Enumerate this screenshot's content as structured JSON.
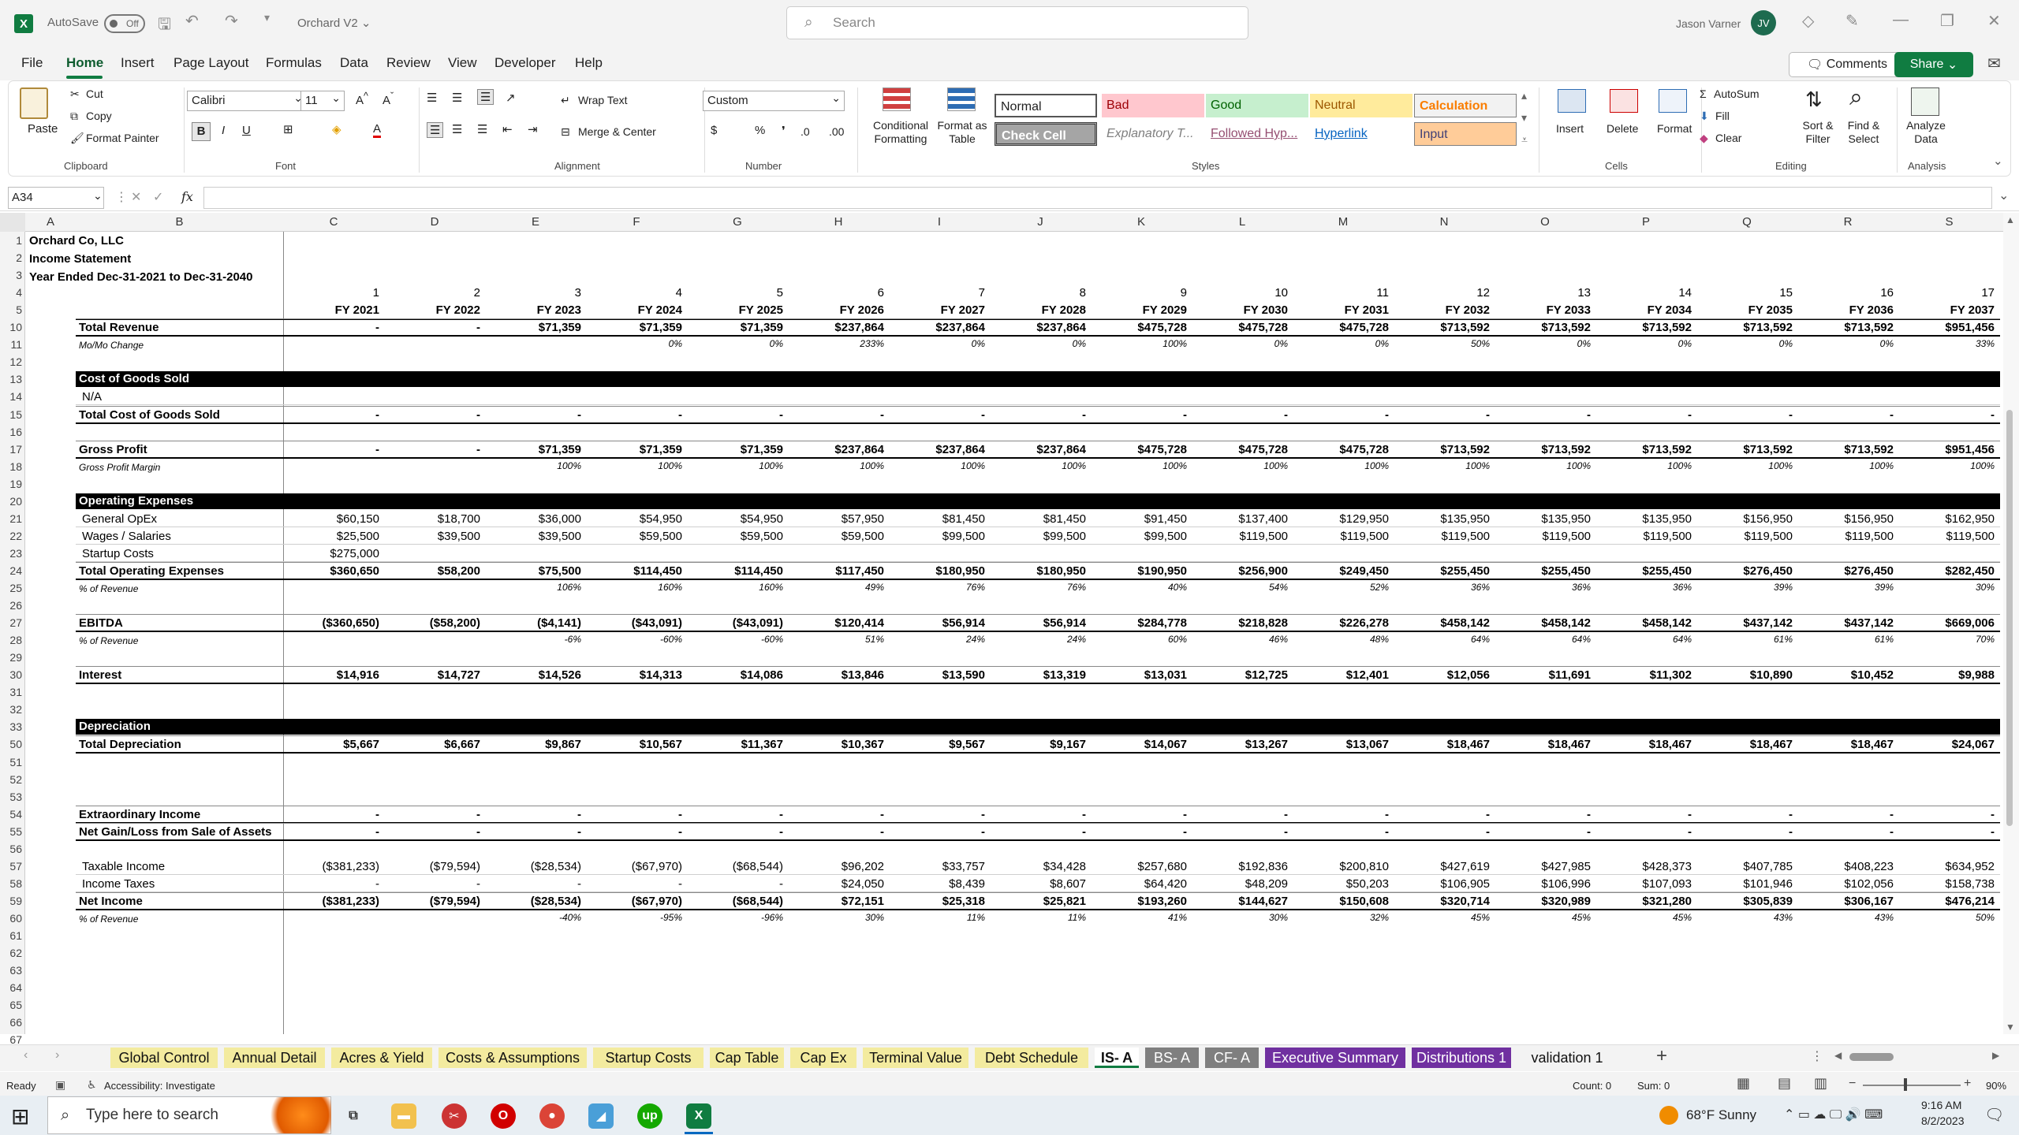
{
  "titlebar": {
    "autosave": "AutoSave",
    "toggle": "Off",
    "doc_title": "Orchard V2 ⌄",
    "search_placeholder": "Search",
    "user": "Jason Varner",
    "initials": "JV"
  },
  "menu": {
    "items": [
      "File",
      "Home",
      "Insert",
      "Page Layout",
      "Formulas",
      "Data",
      "Review",
      "View",
      "Developer",
      "Help"
    ],
    "active": "Home",
    "comments": "Comments",
    "share": "Share"
  },
  "ribbon": {
    "clipboard": {
      "paste": "Paste",
      "cut": "Cut",
      "copy": "Copy",
      "format_painter": "Format Painter",
      "label": "Clipboard"
    },
    "font": {
      "name": "Calibri",
      "size": "11",
      "bold": "B",
      "italic": "I",
      "underline": "U",
      "label": "Font"
    },
    "alignment": {
      "wrap": "Wrap Text",
      "merge": "Merge & Center",
      "label": "Alignment"
    },
    "number": {
      "format": "Custom",
      "label": "Number"
    },
    "styles": {
      "conditional": "Conditional Formatting",
      "format_table": "Format as Table",
      "cells": [
        "Normal",
        "Bad",
        "Good",
        "Neutral",
        "Calculation",
        "Check Cell",
        "Explanatory T...",
        "Followed Hyp...",
        "Hyperlink",
        "Input"
      ],
      "label": "Styles"
    },
    "cells": {
      "insert": "Insert",
      "delete": "Delete",
      "format": "Format",
      "label": "Cells"
    },
    "editing": {
      "autosum": "AutoSum",
      "fill": "Fill",
      "clear": "Clear",
      "sort": "Sort & Filter",
      "find": "Find & Select",
      "label": "Editing"
    },
    "analysis": {
      "analyze": "Analyze Data",
      "label": "Analysis"
    }
  },
  "formula": {
    "namebox": "A34",
    "fx": "fx",
    "content": ""
  },
  "columns": [
    "A",
    "B",
    "C",
    "D",
    "E",
    "F",
    "G",
    "H",
    "I",
    "J",
    "K",
    "L",
    "M",
    "N",
    "O",
    "P",
    "Q",
    "R",
    "S"
  ],
  "rows": [
    "1",
    "2",
    "3",
    "4",
    "5",
    "10",
    "11",
    "12",
    "13",
    "14",
    "15",
    "16",
    "17",
    "18",
    "19",
    "20",
    "21",
    "22",
    "23",
    "24",
    "25",
    "26",
    "27",
    "28",
    "29",
    "30",
    "31",
    "32",
    "33",
    "50",
    "51",
    "52",
    "53",
    "54",
    "55",
    "56",
    "57",
    "58",
    "59",
    "60",
    "61",
    "62",
    "63",
    "64",
    "65",
    "66",
    "67"
  ],
  "sheet": {
    "company": "Orchard Co, LLC",
    "statement": "Income Statement",
    "period": "Year Ended Dec-31-2021 to Dec-31-2040",
    "index": [
      "1",
      "2",
      "3",
      "4",
      "5",
      "6",
      "7",
      "8",
      "9",
      "10",
      "11",
      "12",
      "13",
      "14",
      "15",
      "16",
      "17"
    ],
    "years": [
      "FY 2021",
      "FY 2022",
      "FY 2023",
      "FY 2024",
      "FY 2025",
      "FY 2026",
      "FY 2027",
      "FY 2028",
      "FY 2029",
      "FY 2030",
      "FY 2031",
      "FY 2032",
      "FY 2033",
      "FY 2034",
      "FY 2035",
      "FY 2036",
      "FY 2037"
    ],
    "lines": [
      {
        "label": "Total Revenue",
        "style": "b",
        "values": [
          "-",
          "-",
          "$71,359",
          "$71,359",
          "$71,359",
          "$237,864",
          "$237,864",
          "$237,864",
          "$475,728",
          "$475,728",
          "$475,728",
          "$713,592",
          "$713,592",
          "$713,592",
          "$713,592",
          "$713,592",
          "$951,456"
        ]
      },
      {
        "label": "Mo/Mo Change",
        "style": "it",
        "values": [
          "",
          "",
          "",
          "0%",
          "0%",
          "233%",
          "0%",
          "0%",
          "100%",
          "0%",
          "0%",
          "50%",
          "0%",
          "0%",
          "0%",
          "0%",
          "33%"
        ]
      },
      {
        "label": "Cost of Goods Sold",
        "style": "bar",
        "values": []
      },
      {
        "label": "N/A",
        "style": "n",
        "values": []
      },
      {
        "label": "Total Cost of Goods Sold",
        "style": "b",
        "values": [
          "-",
          "-",
          "-",
          "-",
          "-",
          "-",
          "-",
          "-",
          "-",
          "-",
          "-",
          "-",
          "-",
          "-",
          "-",
          "-",
          "-"
        ]
      },
      {
        "label": "Gross Profit",
        "style": "b",
        "values": [
          "-",
          "-",
          "$71,359",
          "$71,359",
          "$71,359",
          "$237,864",
          "$237,864",
          "$237,864",
          "$475,728",
          "$475,728",
          "$475,728",
          "$713,592",
          "$713,592",
          "$713,592",
          "$713,592",
          "$713,592",
          "$951,456"
        ]
      },
      {
        "label": "Gross Profit Margin",
        "style": "it",
        "values": [
          "",
          "",
          "100%",
          "100%",
          "100%",
          "100%",
          "100%",
          "100%",
          "100%",
          "100%",
          "100%",
          "100%",
          "100%",
          "100%",
          "100%",
          "100%",
          "100%"
        ]
      },
      {
        "label": "Operating Expenses",
        "style": "bar",
        "values": []
      },
      {
        "label": "General OpEx",
        "style": "n",
        "values": [
          "$60,150",
          "$18,700",
          "$36,000",
          "$54,950",
          "$54,950",
          "$57,950",
          "$81,450",
          "$81,450",
          "$91,450",
          "$137,400",
          "$129,950",
          "$135,950",
          "$135,950",
          "$135,950",
          "$156,950",
          "$156,950",
          "$162,950"
        ]
      },
      {
        "label": "Wages / Salaries",
        "style": "n",
        "values": [
          "$25,500",
          "$39,500",
          "$39,500",
          "$59,500",
          "$59,500",
          "$59,500",
          "$99,500",
          "$99,500",
          "$99,500",
          "$119,500",
          "$119,500",
          "$119,500",
          "$119,500",
          "$119,500",
          "$119,500",
          "$119,500",
          "$119,500"
        ]
      },
      {
        "label": "Startup Costs",
        "style": "n",
        "values": [
          "$275,000"
        ]
      },
      {
        "label": "Total Operating Expenses",
        "style": "b",
        "values": [
          "$360,650",
          "$58,200",
          "$75,500",
          "$114,450",
          "$114,450",
          "$117,450",
          "$180,950",
          "$180,950",
          "$190,950",
          "$256,900",
          "$249,450",
          "$255,450",
          "$255,450",
          "$255,450",
          "$276,450",
          "$276,450",
          "$282,450"
        ]
      },
      {
        "label": "% of Revenue",
        "style": "it",
        "values": [
          "",
          "",
          "106%",
          "160%",
          "160%",
          "49%",
          "76%",
          "76%",
          "40%",
          "54%",
          "52%",
          "36%",
          "36%",
          "36%",
          "39%",
          "39%",
          "30%"
        ]
      },
      {
        "label": "EBITDA",
        "style": "b",
        "values": [
          "($360,650)",
          "($58,200)",
          "($4,141)",
          "($43,091)",
          "($43,091)",
          "$120,414",
          "$56,914",
          "$56,914",
          "$284,778",
          "$218,828",
          "$226,278",
          "$458,142",
          "$458,142",
          "$458,142",
          "$437,142",
          "$437,142",
          "$669,006"
        ]
      },
      {
        "label": "% of Revenue",
        "style": "it",
        "values": [
          "",
          "",
          "-6%",
          "-60%",
          "-60%",
          "51%",
          "24%",
          "24%",
          "60%",
          "46%",
          "48%",
          "64%",
          "64%",
          "64%",
          "61%",
          "61%",
          "70%"
        ]
      },
      {
        "label": "Interest",
        "style": "b",
        "values": [
          "$14,916",
          "$14,727",
          "$14,526",
          "$14,313",
          "$14,086",
          "$13,846",
          "$13,590",
          "$13,319",
          "$13,031",
          "$12,725",
          "$12,401",
          "$12,056",
          "$11,691",
          "$11,302",
          "$10,890",
          "$10,452",
          "$9,988"
        ]
      },
      {
        "label": "Depreciation",
        "style": "bar",
        "values": []
      },
      {
        "label": "Total Depreciation",
        "style": "b",
        "values": [
          "$5,667",
          "$6,667",
          "$9,867",
          "$10,567",
          "$11,367",
          "$10,367",
          "$9,567",
          "$9,167",
          "$14,067",
          "$13,267",
          "$13,067",
          "$18,467",
          "$18,467",
          "$18,467",
          "$18,467",
          "$18,467",
          "$24,067"
        ]
      },
      {
        "label": "Extraordinary Income",
        "style": "b",
        "values": [
          "-",
          "-",
          "-",
          "-",
          "-",
          "-",
          "-",
          "-",
          "-",
          "-",
          "-",
          "-",
          "-",
          "-",
          "-",
          "-",
          "-"
        ]
      },
      {
        "label": "Net Gain/Loss from Sale of Assets",
        "style": "b",
        "values": [
          "-",
          "-",
          "-",
          "-",
          "-",
          "-",
          "-",
          "-",
          "-",
          "-",
          "-",
          "-",
          "-",
          "-",
          "-",
          "-",
          "-"
        ]
      },
      {
        "label": "Taxable Income",
        "style": "n",
        "values": [
          "($381,233)",
          "($79,594)",
          "($28,534)",
          "($67,970)",
          "($68,544)",
          "$96,202",
          "$33,757",
          "$34,428",
          "$257,680",
          "$192,836",
          "$200,810",
          "$427,619",
          "$427,985",
          "$428,373",
          "$407,785",
          "$408,223",
          "$634,952"
        ]
      },
      {
        "label": "Income Taxes",
        "style": "n",
        "values": [
          "-",
          "-",
          "-",
          "-",
          "-",
          "$24,050",
          "$8,439",
          "$8,607",
          "$64,420",
          "$48,209",
          "$50,203",
          "$106,905",
          "$106,996",
          "$107,093",
          "$101,946",
          "$102,056",
          "$158,738"
        ]
      },
      {
        "label": "Net Income",
        "style": "b",
        "values": [
          "($381,233)",
          "($79,594)",
          "($28,534)",
          "($67,970)",
          "($68,544)",
          "$72,151",
          "$25,318",
          "$25,821",
          "$193,260",
          "$144,627",
          "$150,608",
          "$320,714",
          "$320,989",
          "$321,280",
          "$305,839",
          "$306,167",
          "$476,214"
        ]
      },
      {
        "label": "% of Revenue",
        "style": "it",
        "values": [
          "",
          "",
          "-40%",
          "-95%",
          "-96%",
          "30%",
          "11%",
          "11%",
          "41%",
          "30%",
          "32%",
          "45%",
          "45%",
          "45%",
          "43%",
          "43%",
          "50%"
        ]
      }
    ]
  },
  "tabs": [
    {
      "name": "Global Control",
      "color": "#f3eb9f"
    },
    {
      "name": "Annual Detail",
      "color": "#f3eb9f"
    },
    {
      "name": "Acres & Yield",
      "color": "#f3eb9f"
    },
    {
      "name": "Costs & Assumptions",
      "color": "#f3eb9f"
    },
    {
      "name": "Startup Costs",
      "color": "#f3eb9f"
    },
    {
      "name": "Cap Table",
      "color": "#f3eb9f"
    },
    {
      "name": "Cap Ex",
      "color": "#f3eb9f"
    },
    {
      "name": "Terminal Value",
      "color": "#f3eb9f"
    },
    {
      "name": "Debt Schedule",
      "color": "#f3eb9f"
    },
    {
      "name": "IS- A",
      "color": "#ffffff"
    },
    {
      "name": "BS- A",
      "color": "#7f7f7f"
    },
    {
      "name": "CF- A",
      "color": "#7f7f7f"
    },
    {
      "name": "Executive Summary",
      "color": "#7030a0"
    },
    {
      "name": "Distributions 1",
      "color": "#7030a0"
    },
    {
      "name": "validation 1",
      "color": "#f3f3f3"
    }
  ],
  "status": {
    "ready": "Ready",
    "accessibility": "Accessibility: Investigate",
    "count": "Count: 0",
    "sum": "Sum: 0",
    "zoom": "90%"
  },
  "taskbar": {
    "search": "Type here to search",
    "weather": "68°F  Sunny",
    "time": "9:16 AM",
    "date": "8/2/2023"
  }
}
